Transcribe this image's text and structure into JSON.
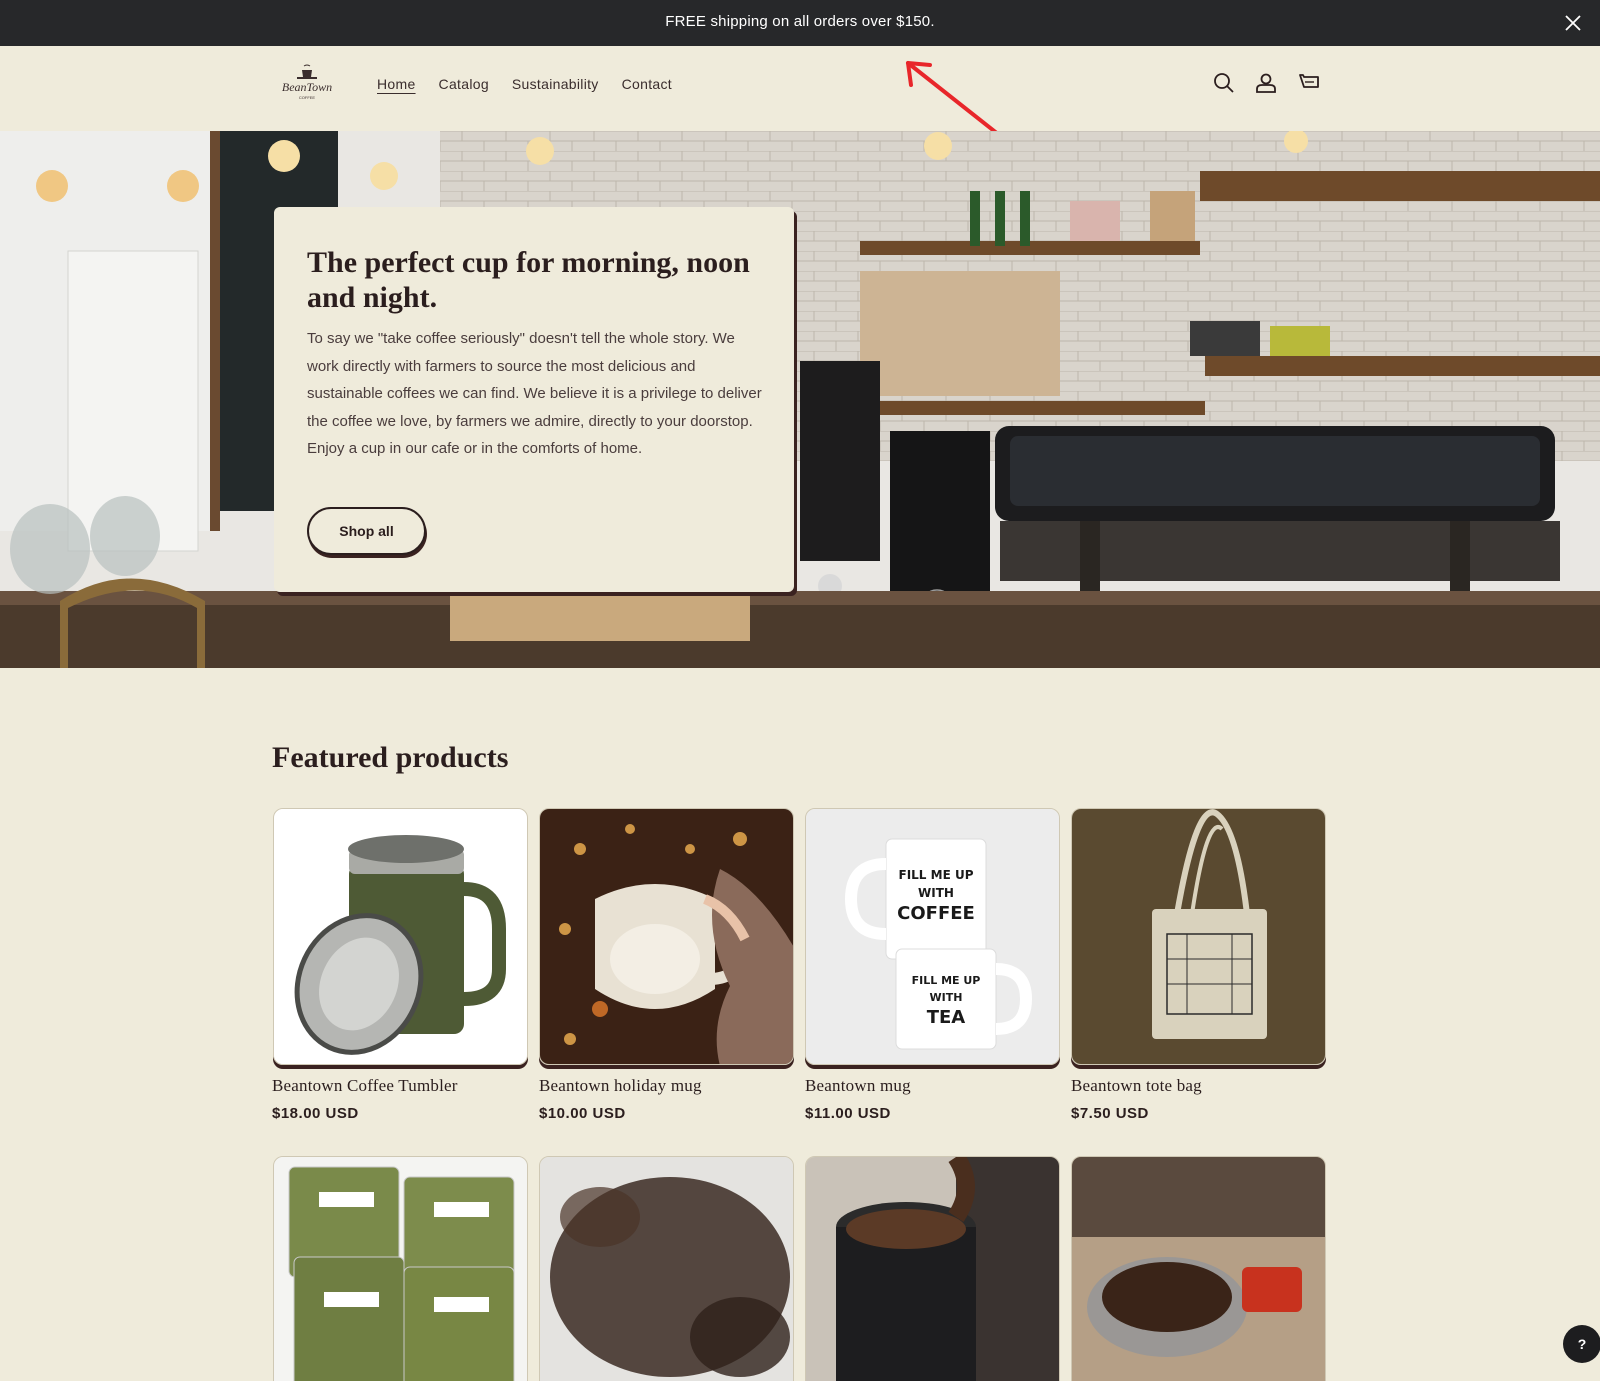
{
  "announcement": {
    "text": "FREE shipping on all orders over $150.",
    "close_icon": "close-icon"
  },
  "header": {
    "logo_text": "BeanTown",
    "logo_subtext": "COFFEE",
    "nav": [
      {
        "label": "Home",
        "active": true
      },
      {
        "label": "Catalog",
        "active": false
      },
      {
        "label": "Sustainability",
        "active": false
      },
      {
        "label": "Contact",
        "active": false
      }
    ],
    "icons": [
      "search-icon",
      "account-icon",
      "cart-icon"
    ]
  },
  "hero": {
    "title": "The perfect cup for morning, noon and night.",
    "body": "To say we \"take coffee seriously\" doesn't tell the whole story. We work directly with farmers to source the most delicious and sustainable coffees we can find. We believe it is a privilege to deliver the coffee we love, by farmers we admire, directly to your doorstop. Enjoy a cup in our cafe or in the comforts of home.",
    "button": "Shop all"
  },
  "featured": {
    "title": "Featured products",
    "products": [
      {
        "name": "Beantown Coffee Tumbler",
        "price": "$18.00 USD"
      },
      {
        "name": "Beantown holiday mug",
        "price": "$10.00 USD"
      },
      {
        "name": "Beantown mug",
        "price": "$11.00 USD"
      },
      {
        "name": "Beantown tote bag",
        "price": "$7.50 USD"
      }
    ]
  },
  "mug_print": {
    "top": [
      "FILL ME UP",
      "WITH",
      "COFFEE"
    ],
    "bottom": [
      "FILL ME UP",
      "WITH",
      "TEA"
    ]
  },
  "help": "?",
  "colors": {
    "background": "#efebdb",
    "announcement_bg": "#27282a",
    "text": "#2b1e1e",
    "annotation_arrow": "#e8262a"
  }
}
